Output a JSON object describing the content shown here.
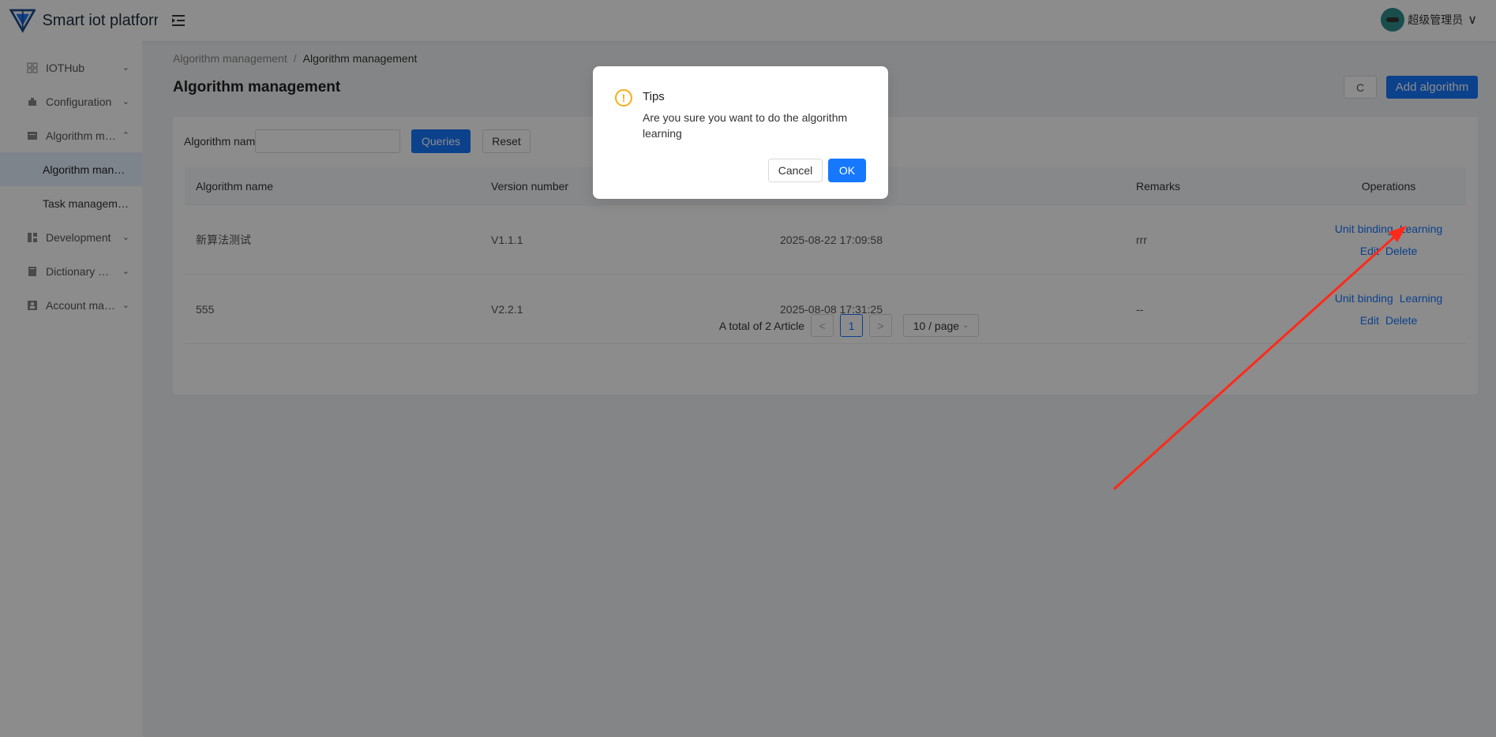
{
  "app": {
    "title": "Smart iot platform",
    "brand_color": "#1677ff"
  },
  "header": {
    "user_name": "超级管理员",
    "menu_icon": "indent-icon"
  },
  "sidebar": {
    "items": [
      {
        "label": "IOTHub",
        "caret": "v"
      },
      {
        "label": "Configuration",
        "caret": "v"
      },
      {
        "label": "Algorithm management",
        "caret": "^"
      },
      {
        "label": "Algorithm management",
        "sub": true,
        "active": true
      },
      {
        "label": "Task management",
        "sub": true
      },
      {
        "label": "Development",
        "caret": "v"
      },
      {
        "label": "Dictionary management",
        "caret": "v"
      },
      {
        "label": "Account management",
        "caret": "v"
      }
    ]
  },
  "breadcrumb": {
    "parent": "Algorithm management",
    "separator": "/",
    "current": "Algorithm management"
  },
  "page": {
    "title": "Algorithm management",
    "refresh_label": "C",
    "add_label": "Add algorithm"
  },
  "search": {
    "label": "Algorithm name :",
    "value": "",
    "query_label": "Queries",
    "reset_label": "Reset"
  },
  "table": {
    "columns": [
      "Algorithm name",
      "Version number",
      "",
      "Remarks",
      "Operations"
    ],
    "rows": [
      {
        "name": "新算法测试",
        "version": "V1.1.1",
        "time": "2025-08-22 17:09:58",
        "remarks": "rrr"
      },
      {
        "name": "555",
        "version": "V2.2.1",
        "time": "2025-08-08 17:31:25",
        "remarks": "--"
      }
    ],
    "ops": {
      "unit_binding": "Unit binding",
      "learning": "Learning",
      "edit": "Edit",
      "delete": "Delete"
    }
  },
  "pagination": {
    "total_text": "A total of 2 Article",
    "prev": "<",
    "current_page": "1",
    "next": ">",
    "page_size": "10 / page"
  },
  "modal": {
    "title": "Tips",
    "icon": "exclamation-circle-icon",
    "content": "Are you sure you want to do the algorithm learning",
    "cancel_label": "Cancel",
    "ok_label": "OK",
    "warn_color": "#faad14"
  },
  "annotation": {
    "arrow_color": "#ff2a1a"
  }
}
